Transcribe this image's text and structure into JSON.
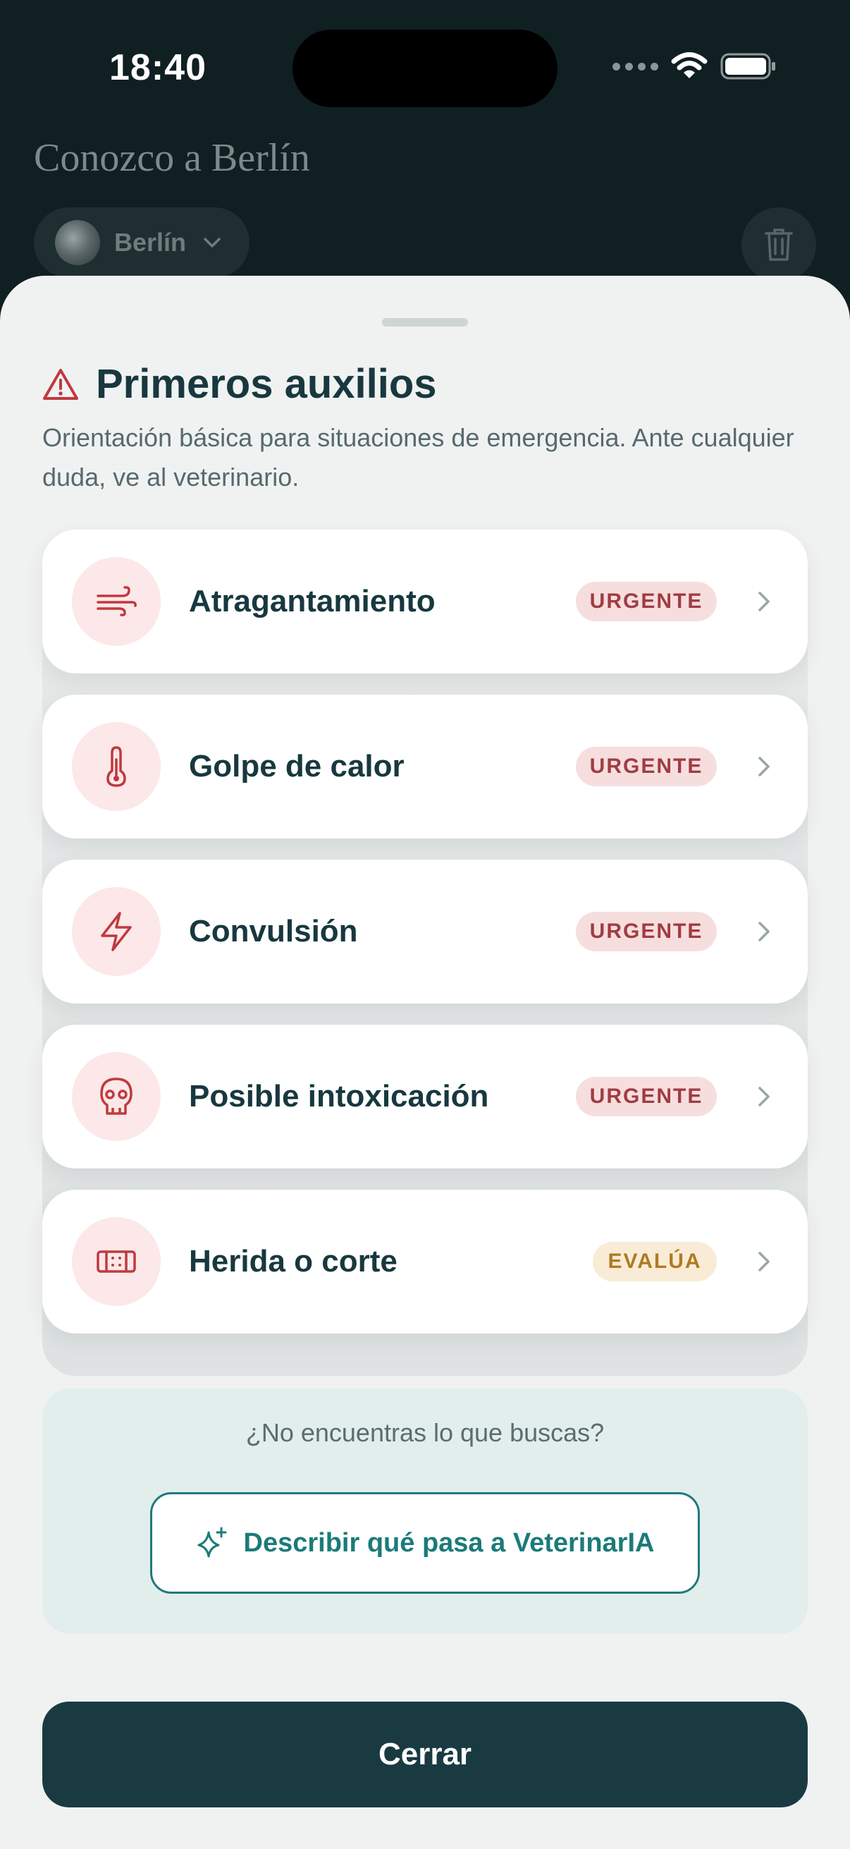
{
  "status_bar": {
    "time": "18:40"
  },
  "background": {
    "title": "Conozco a Berlín",
    "pet_name": "Berlín"
  },
  "sheet": {
    "title": "Primeros auxilios",
    "subtitle": "Orientación básica para situaciones de emergencia. Ante cualquier duda, ve al veterinario.",
    "items": [
      {
        "label": "Atragantamiento",
        "badge": "URGENTE",
        "icon": "wind-icon"
      },
      {
        "label": "Golpe de calor",
        "badge": "URGENTE",
        "icon": "thermometer-icon"
      },
      {
        "label": "Convulsión",
        "badge": "URGENTE",
        "icon": "lightning-icon"
      },
      {
        "label": "Posible intoxicación",
        "badge": "URGENTE",
        "icon": "skull-icon"
      },
      {
        "label": "Herida o corte",
        "badge": "EVALÚA",
        "icon": "bandage-icon"
      }
    ],
    "help": {
      "question": "¿No encuentras lo que buscas?",
      "button_label": "Describir qué pasa a VeterinarIA"
    },
    "close_label": "Cerrar"
  },
  "colors": {
    "accent_red": "#c0393f",
    "urgent_badge_bg": "#f6dede",
    "evalua_badge_text": "#b07a24",
    "teal": "#1b7b79",
    "dark_button": "#1a3a42"
  }
}
